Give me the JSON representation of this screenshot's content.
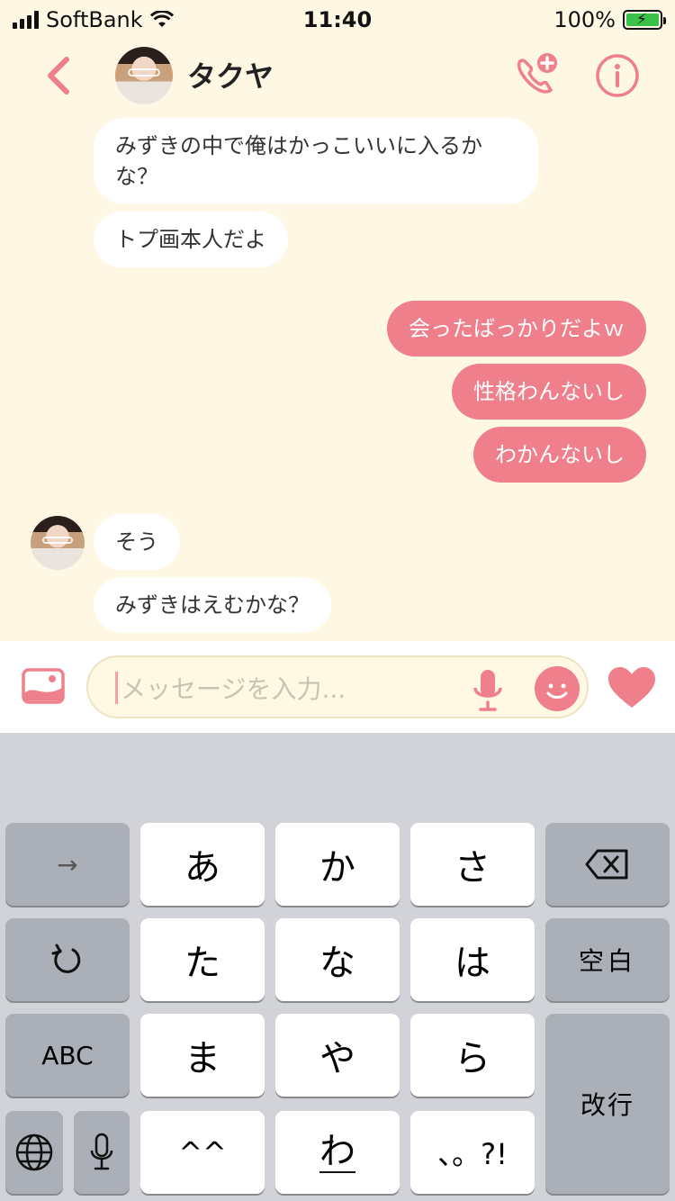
{
  "status": {
    "carrier": "SoftBank",
    "time": "11:40",
    "battery": "100%"
  },
  "header": {
    "name": "タクヤ"
  },
  "messages": {
    "in1": "みずきの中で俺はかっこいいに入るかな？",
    "in2": "トプ画本人だよ",
    "out1": "会ったばっかりだよｗ",
    "out2": "性格わんないし",
    "out3": "わかんないし",
    "in3": "そう",
    "in4": "みずきはえむかな？"
  },
  "input": {
    "placeholder": "メッセージを入力..."
  },
  "keyboard": {
    "arrow": "→",
    "a": "あ",
    "ka": "か",
    "sa": "さ",
    "ta": "た",
    "na": "な",
    "ha": "は",
    "space": "空白",
    "abc": "ABC",
    "ma": "ま",
    "ya": "や",
    "ra": "ら",
    "enter": "改行",
    "kaomoji": "^^",
    "wa": "わ",
    "punct": "、。?!"
  },
  "colors": {
    "accent": "#ef7f8a",
    "background": "#fdf7e4"
  }
}
